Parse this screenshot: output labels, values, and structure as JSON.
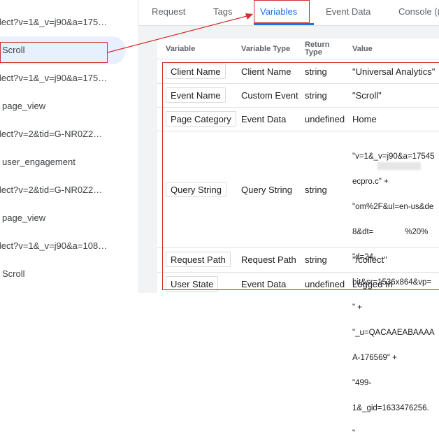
{
  "requests": [
    {
      "label": "llect?v=1&_v=j90&a=175…",
      "type": "url"
    },
    {
      "label": "Scroll",
      "type": "event",
      "selected": true
    },
    {
      "label": "llect?v=1&_v=j90&a=175…",
      "type": "url"
    },
    {
      "label": "page_view",
      "type": "event"
    },
    {
      "label": "llect?v=2&tid=G-NR0Z2…",
      "type": "url"
    },
    {
      "label": "user_engagement",
      "type": "event"
    },
    {
      "label": "llect?v=2&tid=G-NR0Z2…",
      "type": "url"
    },
    {
      "label": "page_view",
      "type": "event"
    },
    {
      "label": "llect?v=1&_v=j90&a=108…",
      "type": "url"
    },
    {
      "label": "Scroll",
      "type": "event"
    }
  ],
  "tabs": [
    {
      "label": "Request"
    },
    {
      "label": "Tags"
    },
    {
      "label": "Variables",
      "active": true
    },
    {
      "label": "Event Data"
    },
    {
      "label": "Console (("
    }
  ],
  "table": {
    "headers": {
      "variable": "Variable",
      "type": "Variable Type",
      "return": "Return\nType",
      "value": "Value"
    },
    "rows": [
      {
        "name": "Client Name",
        "type": "Client Name",
        "return": "string",
        "value": "\"Universal Analytics\""
      },
      {
        "name": "Event Name",
        "type": "Custom Event",
        "return": "string",
        "value": "\"Scroll\""
      },
      {
        "name": "Page Category",
        "type": "Event Data",
        "return": "undefined",
        "value": "Home"
      },
      {
        "name": "Query String",
        "type": "Query String",
        "return": "string",
        "value_lines": [
          "\"v=1&_v=j90&a=17545",
          "ecpro.c\" +",
          "\"om%2F&ul=en-us&de",
          "8&dt=              %20%",
          "\"d=24-",
          "bit&sr=1536x864&vp=",
          "\" +",
          "\"_u=QACAAEABAAAA",
          "A-176569\" +",
          "\"499-",
          "1&_gid=1633476256.",
          "\""
        ]
      },
      {
        "name": "Request Path",
        "type": "Request Path",
        "return": "string",
        "value": "\"/collect\""
      },
      {
        "name": "User State",
        "type": "Event Data",
        "return": "undefined",
        "value": "Logged In"
      }
    ]
  }
}
